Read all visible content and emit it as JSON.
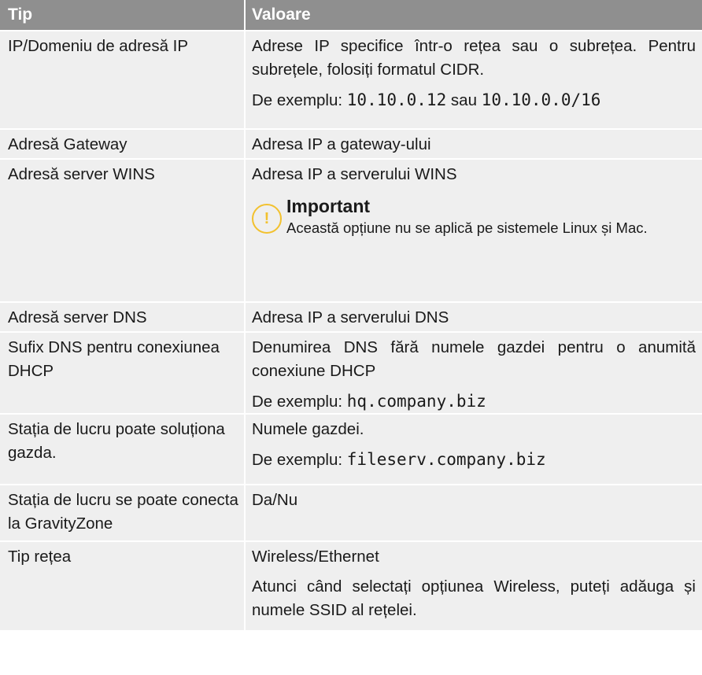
{
  "header": {
    "col1": "Tip",
    "col2": "Valoare"
  },
  "rows": [
    {
      "type": "IP/Domeniu de adresă IP",
      "value": "Adrese IP specifice într-o rețea sau o subrețea. Pentru subrețele, folosiți formatul CIDR.",
      "example_prefix": "De exemplu: ",
      "example_a": "10.10.0.12",
      "example_sep": " sau ",
      "example_b": "10.10.0.0/16"
    },
    {
      "type": "Adresă Gateway",
      "value": "Adresa IP a gateway-ului"
    },
    {
      "type": "Adresă server WINS",
      "value": "Adresa IP a serverului WINS",
      "note_icon": "exclamation-icon",
      "note_title": "Important",
      "note_text": "Această opțiune nu se aplică pe sistemele Linux și Mac."
    },
    {
      "type": "Adresă server DNS",
      "value": "Adresa IP a serverului DNS"
    },
    {
      "type": "Sufix DNS pentru conexiunea DHCP",
      "value": "Denumirea DNS fără numele gazdei pentru o anumită conexiune DHCP",
      "example_prefix": "De exemplu: ",
      "example_code": "hq.company.biz"
    },
    {
      "type": "Stația de lucru poate soluționa gazda.",
      "value": "Numele gazdei.",
      "example_prefix": "De exemplu: ",
      "example_code": "fileserv.company.biz"
    },
    {
      "type": "Stația de lucru se poate conecta la GravityZone",
      "value": "Da/Nu"
    },
    {
      "type": "Tip rețea",
      "value": "Wireless/Ethernet",
      "extra": "Atunci când selectați opțiunea Wireless, puteți adăuga și numele SSID al rețelei."
    }
  ],
  "colors": {
    "header_bg": "#8f8f8f",
    "row_bg": "#efefef",
    "note_accent": "#f2c12e"
  }
}
